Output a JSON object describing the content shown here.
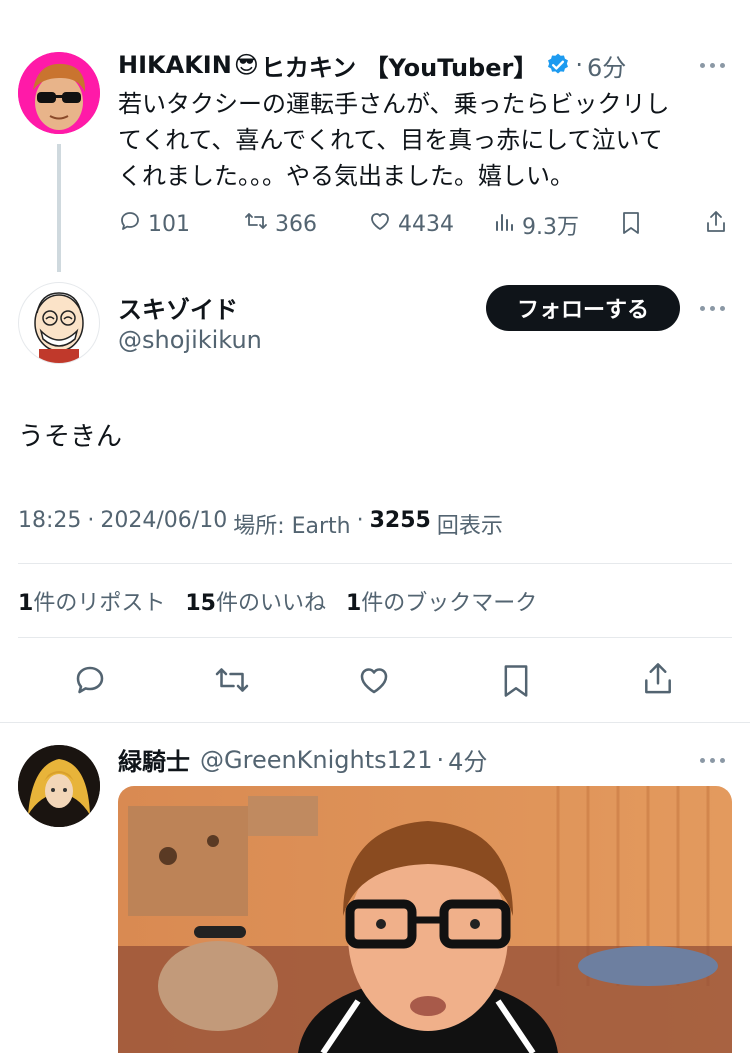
{
  "parent_tweet": {
    "display_name": "HIKAKIN",
    "emoji": "😎",
    "display_name_suffix": "ヒカキン 【YouTuber】",
    "time": "6分",
    "text_lines": [
      "若いタクシーの運転手さんが、乗ったらビックリし",
      "てくれて、喜んでくれて、目を真っ赤にして泣いて",
      "くれました。。。やる気出ました。嬉しい。"
    ],
    "replies": "101",
    "reposts": "366",
    "likes": "4434",
    "views": "9.3万"
  },
  "main_tweet": {
    "display_name": "スキゾイド",
    "handle": "@shojikikun",
    "follow_label": "フォローする",
    "text": "うそきん",
    "time": "18:25",
    "date": "2024/06/10",
    "location": "場所: Earth",
    "views_count": "3255",
    "views_label": "回表示",
    "repost_count": "1",
    "repost_label": "件のリポスト",
    "like_count": "15",
    "like_label": "件のいいね",
    "bookmark_count": "1",
    "bookmark_label": "件のブックマーク"
  },
  "reply_tweet": {
    "display_name": "緑騎士",
    "handle": "@GreenKnights121",
    "time": "4分"
  },
  "colors": {
    "text": "#0f1419",
    "muted": "#536471",
    "verified": "#1d9bf0",
    "follow_bg": "#0f1419",
    "hikakin_avatar_bg": "#ff1aa8"
  },
  "icons": [
    "reply-icon",
    "repost-icon",
    "like-icon",
    "views-icon",
    "bookmark-icon",
    "share-icon",
    "more-icon",
    "verified-badge-icon"
  ]
}
